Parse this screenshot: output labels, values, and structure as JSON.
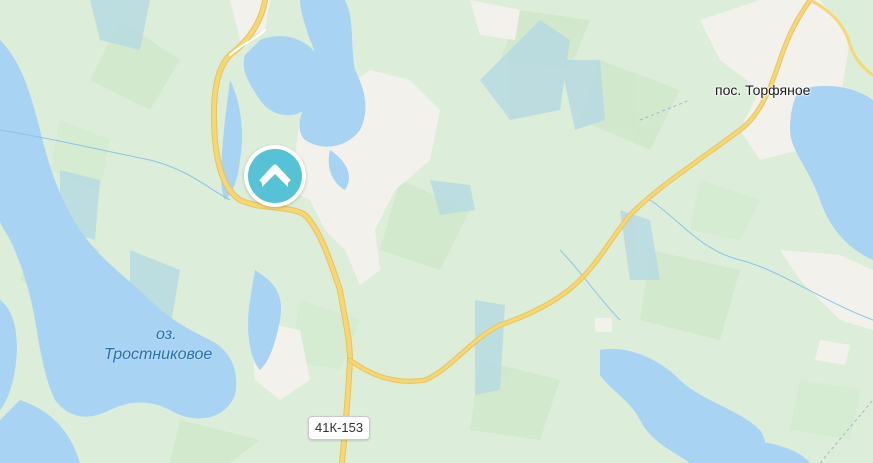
{
  "map": {
    "settlement_label": "пос. Торфяное",
    "lake_label_prefix": "оз.",
    "lake_label_name": "Тростниковое",
    "road_shield": "41К-153",
    "marker_icon": "house-icon",
    "colors": {
      "forest": "#dceeda",
      "water": "#a8d3f2",
      "road": "#f7d774",
      "settlement": "#f3f1ec",
      "marker": "#55c2d6"
    }
  }
}
